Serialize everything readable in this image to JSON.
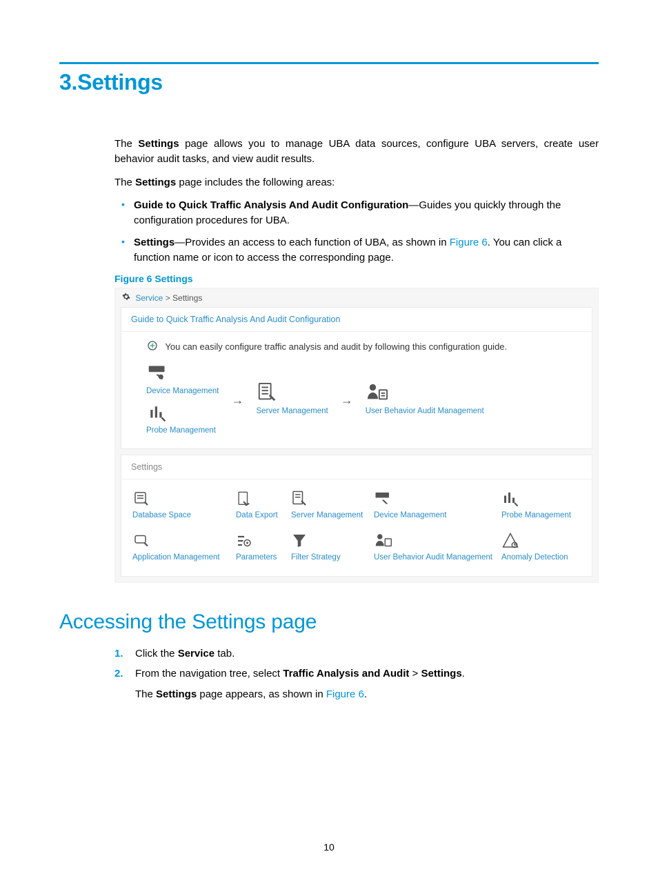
{
  "chapter_title": "3.Settings",
  "intro": {
    "p1_pre": "The ",
    "p1_b1": "Settings",
    "p1_post": " page allows you to manage UBA data sources, configure UBA servers, create user behavior audit tasks, and view audit results.",
    "p2_pre": "The ",
    "p2_b1": "Settings",
    "p2_post": " page includes the following areas:"
  },
  "bullets": {
    "b1_strong": "Guide to Quick Traffic Analysis And Audit Configuration",
    "b1_rest": "—Guides you quickly through the configuration procedures for UBA.",
    "b2_strong": "Settings",
    "b2_mid": "—Provides an access to each function of UBA, as shown in ",
    "b2_link": "Figure 6",
    "b2_rest": ". You can click a function name or icon to access the corresponding page."
  },
  "figure_caption": "Figure 6 Settings",
  "shot": {
    "breadcrumb_service": "Service",
    "breadcrumb_sep": " > ",
    "breadcrumb_settings": "Settings",
    "guide_panel_title": "Guide to Quick Traffic Analysis And Audit Configuration",
    "guide_msg": "You can easily configure traffic analysis and audit by following this configuration guide.",
    "flow": {
      "device": "Device Management",
      "probe": "Probe Management",
      "server": "Server Management",
      "uba": "User Behavior Audit Management"
    },
    "settings_panel_title": "Settings",
    "grid": {
      "db": "Database Space",
      "export": "Data Export",
      "server": "Server Management",
      "device": "Device Management",
      "probe": "Probe Management",
      "app": "Application Management",
      "params": "Parameters",
      "filter": "Filter Strategy",
      "uba": "User Behavior Audit Management",
      "anomaly": "Anomaly Detection"
    }
  },
  "section_title": "Accessing the Settings page",
  "steps": {
    "s1_pre": "Click the ",
    "s1_b": "Service",
    "s1_post": " tab.",
    "s2_pre": "From the navigation tree, select ",
    "s2_b1": "Traffic Analysis and Audit",
    "s2_mid": " > ",
    "s2_b2": "Settings",
    "s2_post": ".",
    "s2_line2_pre": "The ",
    "s2_line2_b": "Settings",
    "s2_line2_mid": " page appears, as shown in ",
    "s2_line2_link": "Figure 6",
    "s2_line2_post": "."
  },
  "page_number": "10",
  "colors": {
    "brand": "#0096d6"
  }
}
